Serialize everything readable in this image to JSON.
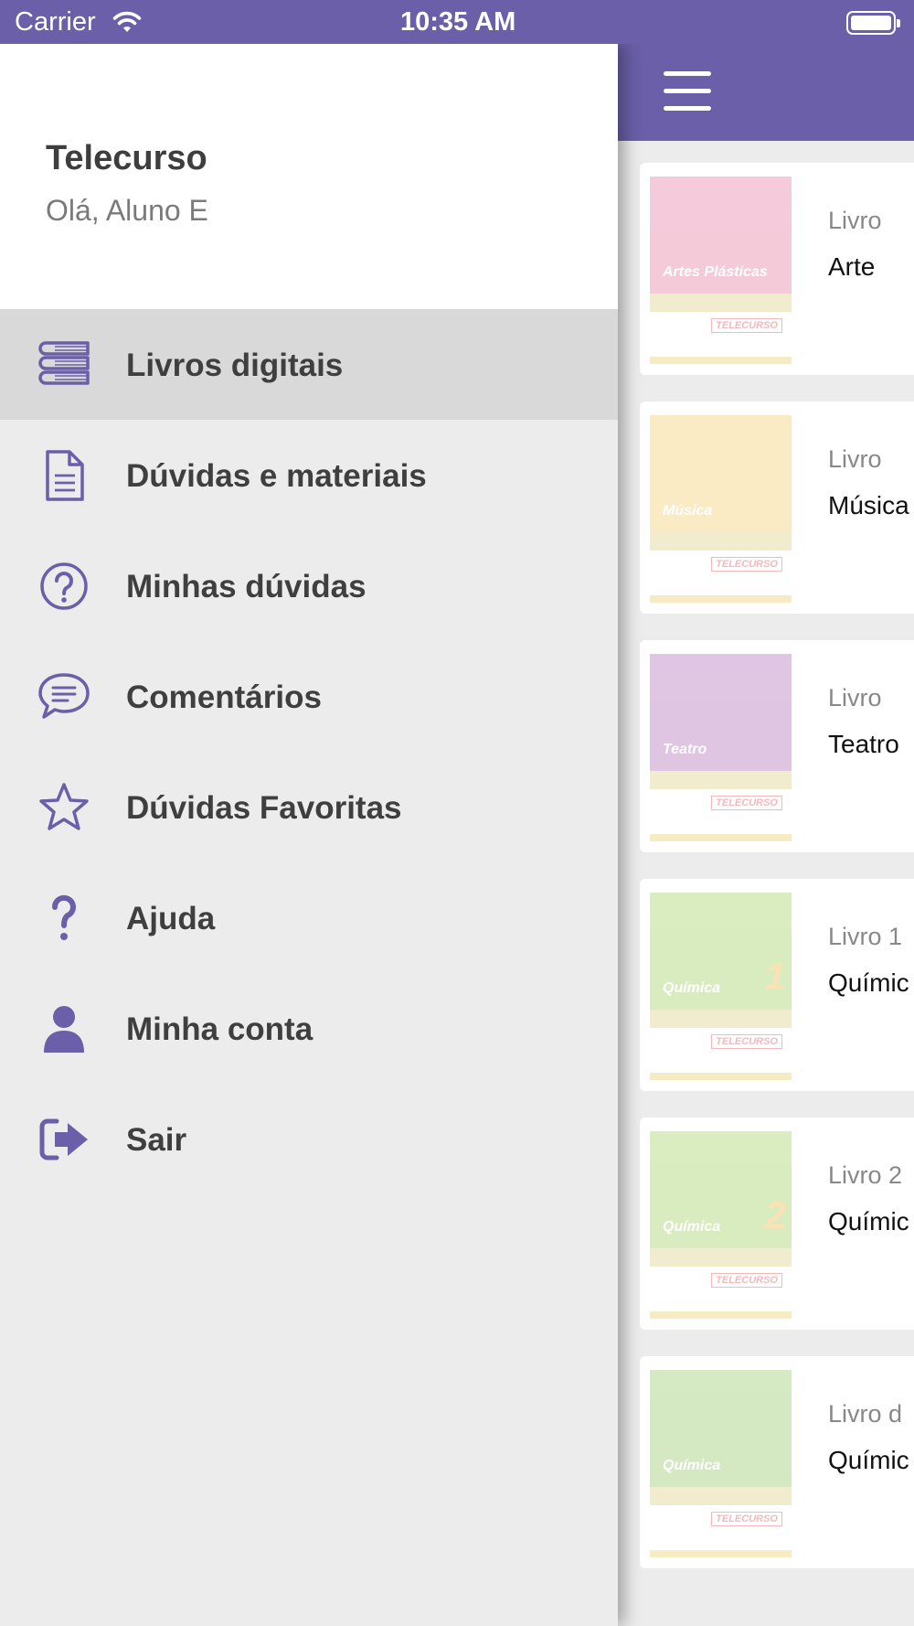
{
  "status_bar": {
    "carrier": "Carrier",
    "time": "10:35 AM"
  },
  "drawer": {
    "app_name": "Telecurso",
    "greeting": "Olá, Aluno E",
    "accent_color": "#6a5fa8",
    "items": [
      {
        "label": "Livros digitais",
        "icon": "books-icon",
        "active": true
      },
      {
        "label": "Dúvidas e materiais",
        "icon": "document-icon",
        "active": false
      },
      {
        "label": "Minhas dúvidas",
        "icon": "question-circle-icon",
        "active": false
      },
      {
        "label": "Comentários",
        "icon": "comment-icon",
        "active": false
      },
      {
        "label": "Dúvidas Favoritas",
        "icon": "star-icon",
        "active": false
      },
      {
        "label": "Ajuda",
        "icon": "question-mark-icon",
        "active": false
      },
      {
        "label": "Minha conta",
        "icon": "user-icon",
        "active": false
      },
      {
        "label": "Sair",
        "icon": "sign-out-icon",
        "active": false
      }
    ]
  },
  "books": [
    {
      "kind": "Livro",
      "title": "Arte",
      "cover_text": "Artes Plásticas",
      "cover_color": "#e05c8c"
    },
    {
      "kind": "Livro",
      "title": "Música",
      "cover_text": "Música",
      "cover_color": "#f2c24a"
    },
    {
      "kind": "Livro",
      "title": "Teatro",
      "cover_text": "Teatro",
      "cover_color": "#a24fa8"
    },
    {
      "kind": "Livro 1",
      "title": "Químic",
      "cover_text": "Química",
      "cover_color": "#8cc63f",
      "cover_number": "1"
    },
    {
      "kind": "Livro 2",
      "title": "Químic",
      "cover_text": "Química",
      "cover_color": "#8cc63f",
      "cover_number": "2"
    },
    {
      "kind": "Livro d",
      "title": "Químic",
      "cover_text": "Química",
      "cover_color": "#7dbb42"
    }
  ]
}
